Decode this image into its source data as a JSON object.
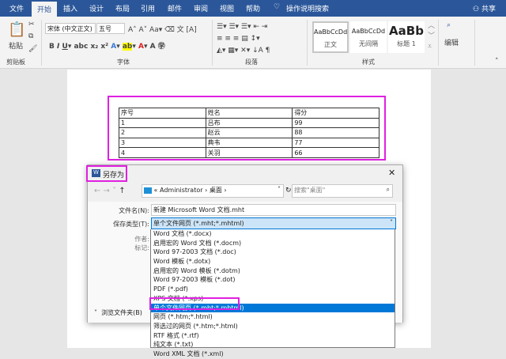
{
  "tabs": [
    "文件",
    "开始",
    "插入",
    "设计",
    "布局",
    "引用",
    "邮件",
    "审阅",
    "视图",
    "帮助"
  ],
  "active_tab": "开始",
  "tell_me": "操作说明搜索",
  "share": "共享",
  "ribbon": {
    "paste": "粘贴",
    "clipboard": "剪贴板",
    "font_name": "宋体 (中文正文)",
    "font_size": "五号",
    "font_group": "字体",
    "paragraph_group": "段落",
    "styles": [
      {
        "preview": "AaBbCcDd",
        "name": "正文"
      },
      {
        "preview": "AaBbCcDd",
        "name": "无间隔"
      },
      {
        "preview": "AaBb",
        "name": "标题 1"
      }
    ],
    "styles_group": "样式",
    "editing": "编辑"
  },
  "table": {
    "header": [
      "序号",
      "姓名",
      "得分"
    ],
    "rows": [
      [
        "1",
        "吕布",
        "99"
      ],
      [
        "2",
        "赵云",
        "88"
      ],
      [
        "3",
        "典韦",
        "77"
      ],
      [
        "4",
        "关羽",
        "66"
      ]
    ]
  },
  "dialog": {
    "title": "另存为",
    "breadcrumb": [
      "Administrator",
      "桌面"
    ],
    "search_placeholder": "搜索\"桌面\"",
    "filename_label": "文件名(N):",
    "filename": "新建 Microsoft Word 文档.mht",
    "type_label": "保存类型(T):",
    "type_value": "单个文件网页 (*.mht;*.mhtml)",
    "author_label": "作者:",
    "tags_label": "标记:",
    "browse": "浏览文件夹(B)",
    "options": [
      "Word 文档 (*.docx)",
      "启用宏的 Word 文档 (*.docm)",
      "Word 97-2003 文档 (*.doc)",
      "Word 模板 (*.dotx)",
      "启用宏的 Word 模板 (*.dotm)",
      "Word 97-2003 模板 (*.dot)",
      "PDF (*.pdf)",
      "XPS 文档 (*.xps)",
      "单个文件网页 (*.mht;*.mhtml)",
      "网页 (*.htm;*.html)",
      "筛选过的网页 (*.htm;*.html)",
      "RTF 格式 (*.rtf)",
      "纯文本 (*.txt)",
      "Word XML 文档 (*.xml)"
    ],
    "selected_index": 8
  },
  "colors": {
    "brand": "#2b579a",
    "highlight": "#e020e0",
    "selection": "#0078d7"
  }
}
